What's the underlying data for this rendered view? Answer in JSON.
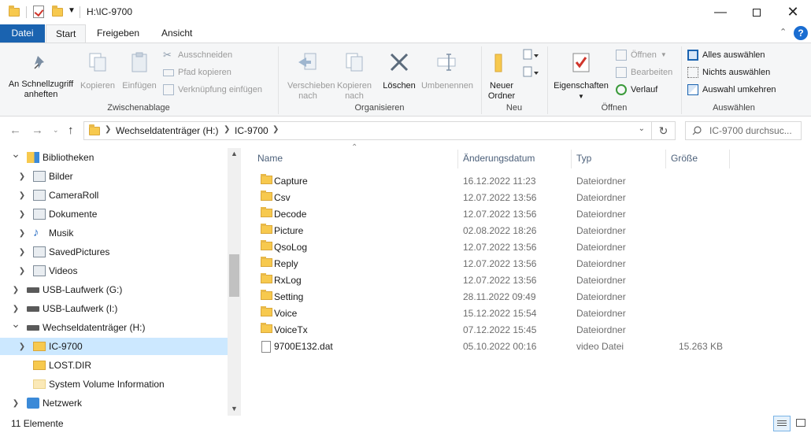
{
  "window": {
    "title": "H:\\IC-9700"
  },
  "ribbon_tabs": [
    "Datei",
    "Start",
    "Freigeben",
    "Ansicht"
  ],
  "clipboard": {
    "pin": "An Schnellzugriff anheften",
    "copy": "Kopieren",
    "paste": "Einfügen",
    "cut": "Ausschneiden",
    "copy_path": "Pfad kopieren",
    "paste_shortcut": "Verknüpfung einfügen",
    "group": "Zwischenablage"
  },
  "organize": {
    "move": "Verschieben nach",
    "copy_to": "Kopieren nach",
    "delete": "Löschen",
    "rename": "Umbenennen",
    "group": "Organisieren"
  },
  "new_group": {
    "new_folder": "Neuer Ordner",
    "group": "Neu"
  },
  "open_group": {
    "properties": "Eigenschaften",
    "open": "Öffnen",
    "edit": "Bearbeiten",
    "history": "Verlauf",
    "group": "Öffnen"
  },
  "select_group": {
    "select_all": "Alles auswählen",
    "select_none": "Nichts auswählen",
    "invert": "Auswahl umkehren",
    "group": "Auswählen"
  },
  "address": {
    "crumbs": [
      "Wechseldatenträger (H:)",
      "IC-9700"
    ],
    "search_placeholder": "IC-9700 durchsuc..."
  },
  "tree": [
    {
      "label": "Bibliotheken",
      "indent": 0,
      "chevron": "down",
      "icon": "libraries-icon"
    },
    {
      "label": "Bilder",
      "indent": 1,
      "chevron": "right",
      "icon": "pictures-icon"
    },
    {
      "label": "CameraRoll",
      "indent": 1,
      "chevron": "right",
      "icon": "pictures-icon"
    },
    {
      "label": "Dokumente",
      "indent": 1,
      "chevron": "right",
      "icon": "documents-icon"
    },
    {
      "label": "Musik",
      "indent": 1,
      "chevron": "right",
      "icon": "music-icon"
    },
    {
      "label": "SavedPictures",
      "indent": 1,
      "chevron": "right",
      "icon": "pictures-icon"
    },
    {
      "label": "Videos",
      "indent": 1,
      "chevron": "right",
      "icon": "videos-icon"
    },
    {
      "label": "USB-Laufwerk (G:)",
      "indent": 0,
      "chevron": "right",
      "icon": "drive-icon"
    },
    {
      "label": "USB-Laufwerk (I:)",
      "indent": 0,
      "chevron": "right",
      "icon": "drive-icon"
    },
    {
      "label": "Wechseldatenträger (H:)",
      "indent": 0,
      "chevron": "down",
      "icon": "drive-icon"
    },
    {
      "label": "IC-9700",
      "indent": 1,
      "chevron": "right",
      "icon": "folder-icon",
      "selected": true
    },
    {
      "label": "LOST.DIR",
      "indent": 1,
      "chevron": "",
      "icon": "folder-icon"
    },
    {
      "label": "System Volume Information",
      "indent": 1,
      "chevron": "",
      "icon": "folder-light-icon"
    },
    {
      "label": "Netzwerk",
      "indent": 0,
      "chevron": "right",
      "icon": "network-icon"
    }
  ],
  "columns": {
    "name": "Name",
    "date": "Änderungsdatum",
    "type": "Typ",
    "size": "Größe"
  },
  "files": [
    {
      "name": "Capture",
      "date": "16.12.2022 11:23",
      "type": "Dateiordner",
      "size": "",
      "kind": "folder"
    },
    {
      "name": "Csv",
      "date": "12.07.2022 13:56",
      "type": "Dateiordner",
      "size": "",
      "kind": "folder"
    },
    {
      "name": "Decode",
      "date": "12.07.2022 13:56",
      "type": "Dateiordner",
      "size": "",
      "kind": "folder"
    },
    {
      "name": "Picture",
      "date": "02.08.2022 18:26",
      "type": "Dateiordner",
      "size": "",
      "kind": "folder"
    },
    {
      "name": "QsoLog",
      "date": "12.07.2022 13:56",
      "type": "Dateiordner",
      "size": "",
      "kind": "folder"
    },
    {
      "name": "Reply",
      "date": "12.07.2022 13:56",
      "type": "Dateiordner",
      "size": "",
      "kind": "folder"
    },
    {
      "name": "RxLog",
      "date": "12.07.2022 13:56",
      "type": "Dateiordner",
      "size": "",
      "kind": "folder"
    },
    {
      "name": "Setting",
      "date": "28.11.2022 09:49",
      "type": "Dateiordner",
      "size": "",
      "kind": "folder"
    },
    {
      "name": "Voice",
      "date": "15.12.2022 15:54",
      "type": "Dateiordner",
      "size": "",
      "kind": "folder"
    },
    {
      "name": "VoiceTx",
      "date": "07.12.2022 15:45",
      "type": "Dateiordner",
      "size": "",
      "kind": "folder"
    },
    {
      "name": "9700E132.dat",
      "date": "05.10.2022 00:16",
      "type": "video Datei",
      "size": "15.263 KB",
      "kind": "file"
    }
  ],
  "status": {
    "count": "11 Elemente"
  },
  "colors": {
    "accent": "#1a63b0",
    "selection": "#cce8ff",
    "folder": "#f7c94e"
  }
}
